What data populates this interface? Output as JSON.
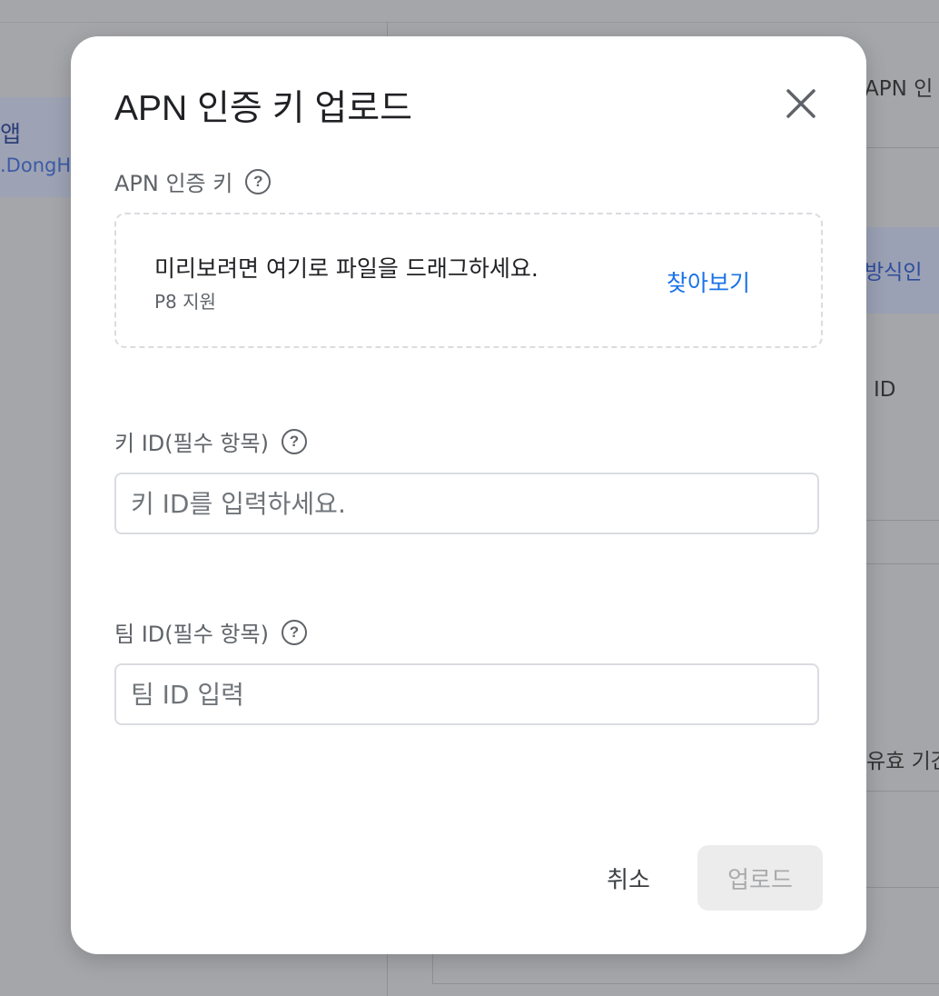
{
  "background": {
    "left_card_title": "앱",
    "left_card_subtitle": ".DongH",
    "right_texts": {
      "apn": "APN 인",
      "method": "방식인",
      "id": "ID",
      "expiry": "유효 기간"
    }
  },
  "dialog": {
    "title": "APN 인증 키 업로드",
    "apn_key": {
      "label": "APN 인증 키",
      "dropzone_main": "미리보려면 여기로 파일을 드래그하세요.",
      "dropzone_sub": "P8 지원",
      "browse_label": "찾아보기"
    },
    "key_id": {
      "label": "키 ID(필수 항목)",
      "placeholder": "키 ID를 입력하세요.",
      "value": ""
    },
    "team_id": {
      "label": "팀 ID(필수 항목)",
      "placeholder": "팀 ID 입력",
      "value": ""
    },
    "cancel_label": "취소",
    "upload_label": "업로드"
  },
  "colors": {
    "accent": "#1a73e8",
    "scrim": "#a5a6aa",
    "disabled_bg": "#ececec"
  }
}
